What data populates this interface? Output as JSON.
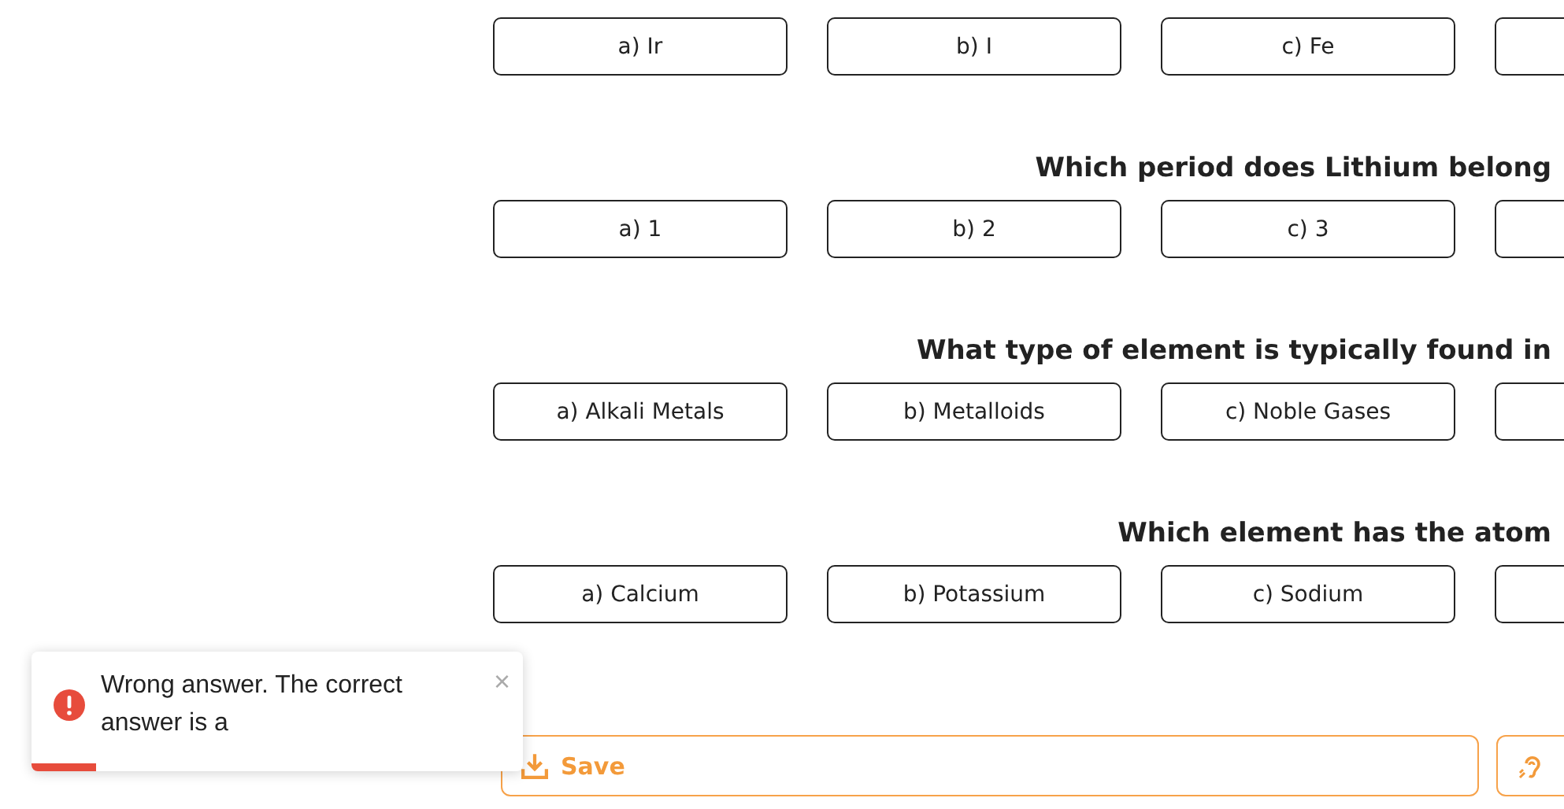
{
  "questions": [
    {
      "options": [
        "a) Ir",
        "b) I",
        "c) Fe"
      ],
      "clipped_option": true
    },
    {
      "question": "Which period does Lithium belong",
      "options": [
        "a) 1",
        "b) 2",
        "c) 3"
      ],
      "clipped_option": true
    },
    {
      "question": "What type of element is typically found in",
      "options": [
        "a) Alkali Metals",
        "b) Metalloids",
        "c) Noble Gases"
      ],
      "clipped_option": true
    },
    {
      "question": "Which element has the atom",
      "options": [
        "a) Calcium",
        "b) Potassium",
        "c) Sodium"
      ],
      "clipped_option": true
    }
  ],
  "actions": [
    {
      "kind": "save",
      "label": "Save"
    },
    {
      "kind": "listen"
    }
  ],
  "toast": {
    "kind": "error",
    "message": "Wrong answer. The correct answer is a",
    "close": "×",
    "level": 0.13
  }
}
